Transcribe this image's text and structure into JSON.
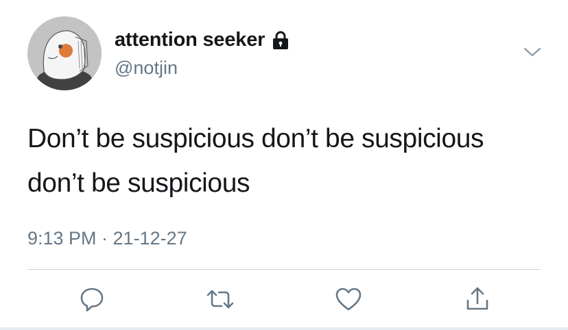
{
  "tweet": {
    "author": {
      "display_name": "attention seeker",
      "handle": "@notjin",
      "protected_icon": "lock-icon",
      "avatar": "avatar-illustration"
    },
    "text": "Don’t be suspicious don’t be suspicious don’t be suspicious",
    "timestamp": "9:13 PM · 21-12-27"
  },
  "actions": [
    {
      "name": "reply",
      "icon": "reply-icon"
    },
    {
      "name": "retweet",
      "icon": "retweet-icon"
    },
    {
      "name": "like",
      "icon": "heart-icon"
    },
    {
      "name": "share",
      "icon": "share-icon"
    }
  ],
  "more_icon": "chevron-down-icon",
  "colors": {
    "text": "#14171a",
    "secondary": "#657786",
    "divider": "#ccd6dd"
  }
}
